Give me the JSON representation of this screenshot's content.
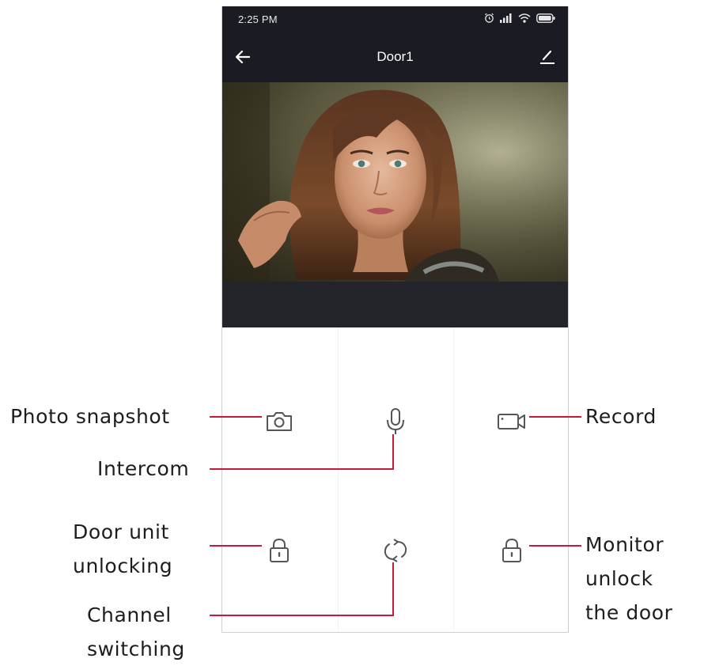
{
  "status_bar": {
    "time": "2:25 PM"
  },
  "nav": {
    "title": "Door1"
  },
  "controls": {
    "snapshot": "camera-icon",
    "intercom": "microphone-icon",
    "record": "video-camera-icon",
    "door_unit_unlock": "lock-icon",
    "channel_switch": "refresh-icon",
    "monitor_unlock": "lock-icon"
  },
  "callouts": {
    "photo_snapshot": "Photo snapshot",
    "intercom": "Intercom",
    "record": "Record",
    "door_unit_unlocking": [
      "Door unit",
      "unlocking"
    ],
    "channel_switching": [
      "Channel",
      "switching"
    ],
    "monitor_unlock": [
      "Monitor",
      "unlock",
      "the door"
    ]
  },
  "colors": {
    "dark_bar": "#1b1c23",
    "accent_line": "#c8193b",
    "icon_gray": "#555555"
  }
}
